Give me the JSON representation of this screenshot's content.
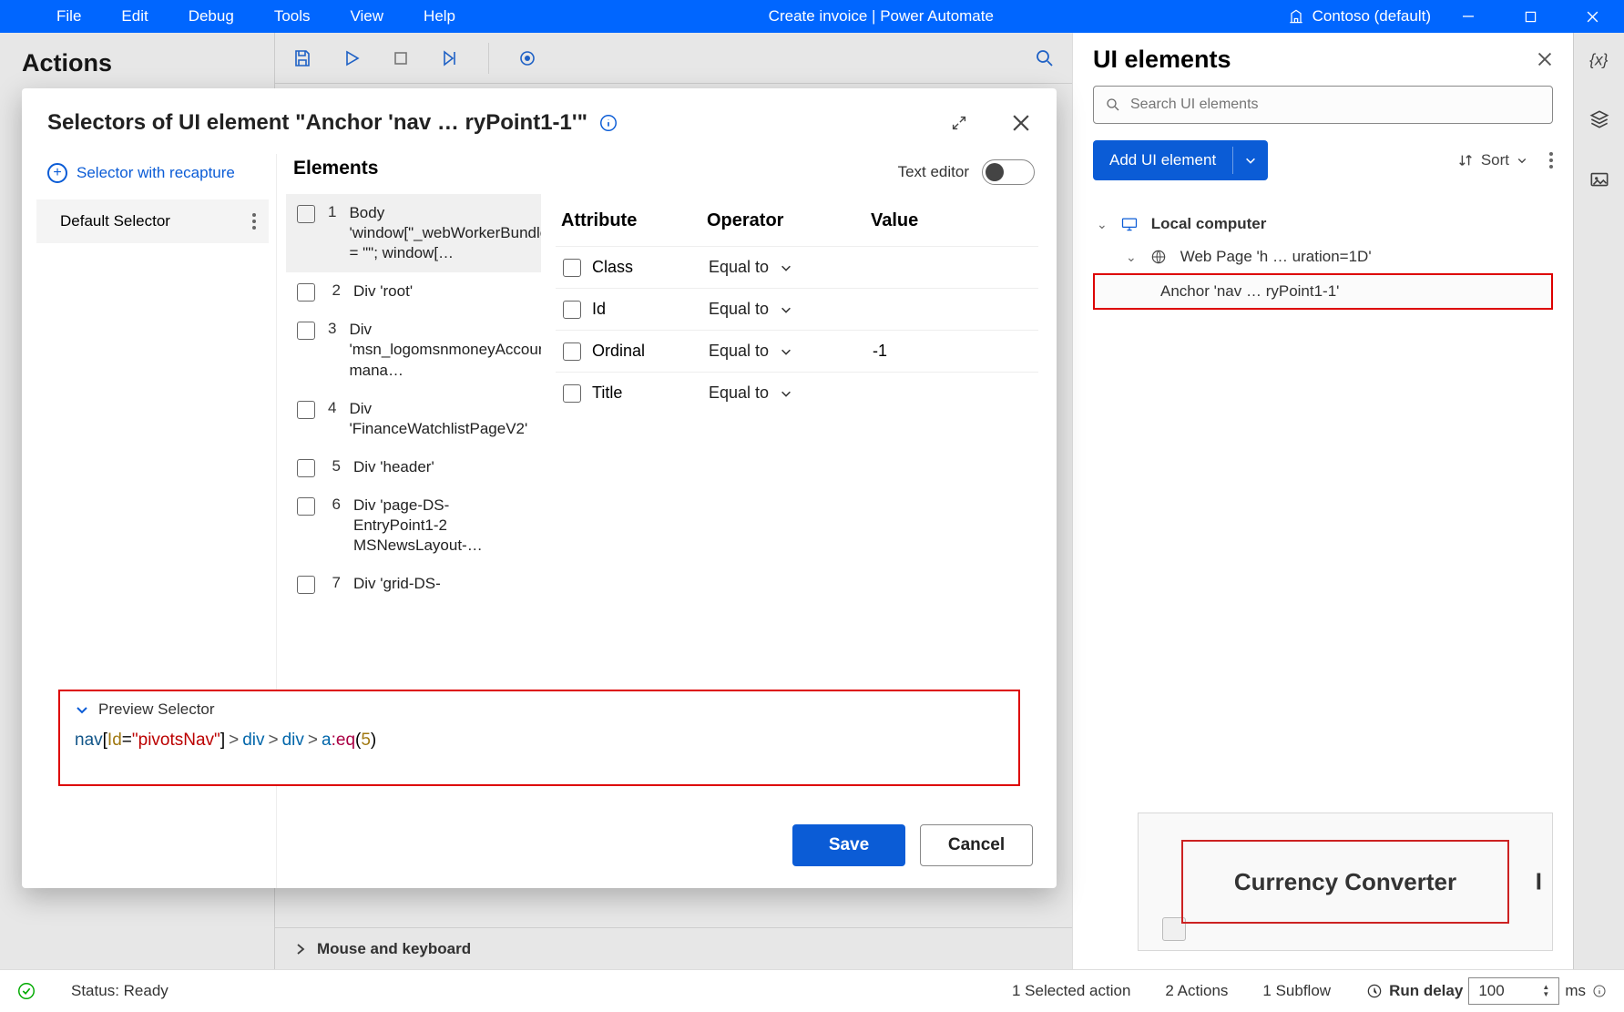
{
  "titlebar": {
    "menus": [
      "File",
      "Edit",
      "Debug",
      "Tools",
      "View",
      "Help"
    ],
    "center": "Create invoice | Power Automate",
    "org": "Contoso (default)"
  },
  "actions_header": "Actions",
  "ui_panel": {
    "title": "UI elements",
    "search_placeholder": "Search UI elements",
    "add_label": "Add UI element",
    "sort_label": "Sort",
    "tree": {
      "root": "Local computer",
      "page": "Web Page 'h … uration=1D'",
      "anchor": "Anchor 'nav … ryPoint1-1'"
    },
    "thumb_label": "Currency Converter"
  },
  "mouse_kb": "Mouse and keyboard",
  "statusbar": {
    "status": "Status: Ready",
    "selected": "1 Selected action",
    "actions": "2 Actions",
    "subflow": "1 Subflow",
    "rundelay_label": "Run delay",
    "rundelay_value": "100",
    "rundelay_unit": "ms"
  },
  "modal": {
    "title": "Selectors of UI element \"Anchor 'nav … ryPoint1-1'\"",
    "recapture": "Selector with recapture",
    "default_selector": "Default Selector",
    "elements_header": "Elements",
    "text_editor_label": "Text editor",
    "elements": [
      {
        "n": "1",
        "label": "Body 'window[\"_webWorkerBundle\"] = \"\"; window[…"
      },
      {
        "n": "2",
        "label": "Div 'root'"
      },
      {
        "n": "3",
        "label": "Div 'msn_logomsnmoneyAccount mana…"
      },
      {
        "n": "4",
        "label": "Div 'FinanceWatchlistPageV2'"
      },
      {
        "n": "5",
        "label": "Div 'header'"
      },
      {
        "n": "6",
        "label": "Div 'page-DS-EntryPoint1-2 MSNewsLayout-…"
      },
      {
        "n": "7",
        "label": "Div 'grid-DS-"
      }
    ],
    "attr_headers": {
      "attr": "Attribute",
      "op": "Operator",
      "val": "Value"
    },
    "attrs": [
      {
        "name": "Class",
        "op": "Equal to",
        "val": ""
      },
      {
        "name": "Id",
        "op": "Equal to",
        "val": ""
      },
      {
        "name": "Ordinal",
        "op": "Equal to",
        "val": "-1"
      },
      {
        "name": "Title",
        "op": "Equal to",
        "val": ""
      }
    ],
    "preview_label": "Preview Selector",
    "preview_tokens": {
      "a": "nav",
      "b": "Id",
      "c": "=",
      "d": "\"pivotsNav\"",
      "e": "div",
      "f": "a",
      "g": ":eq",
      "h": "5"
    },
    "save": "Save",
    "cancel": "Cancel"
  }
}
